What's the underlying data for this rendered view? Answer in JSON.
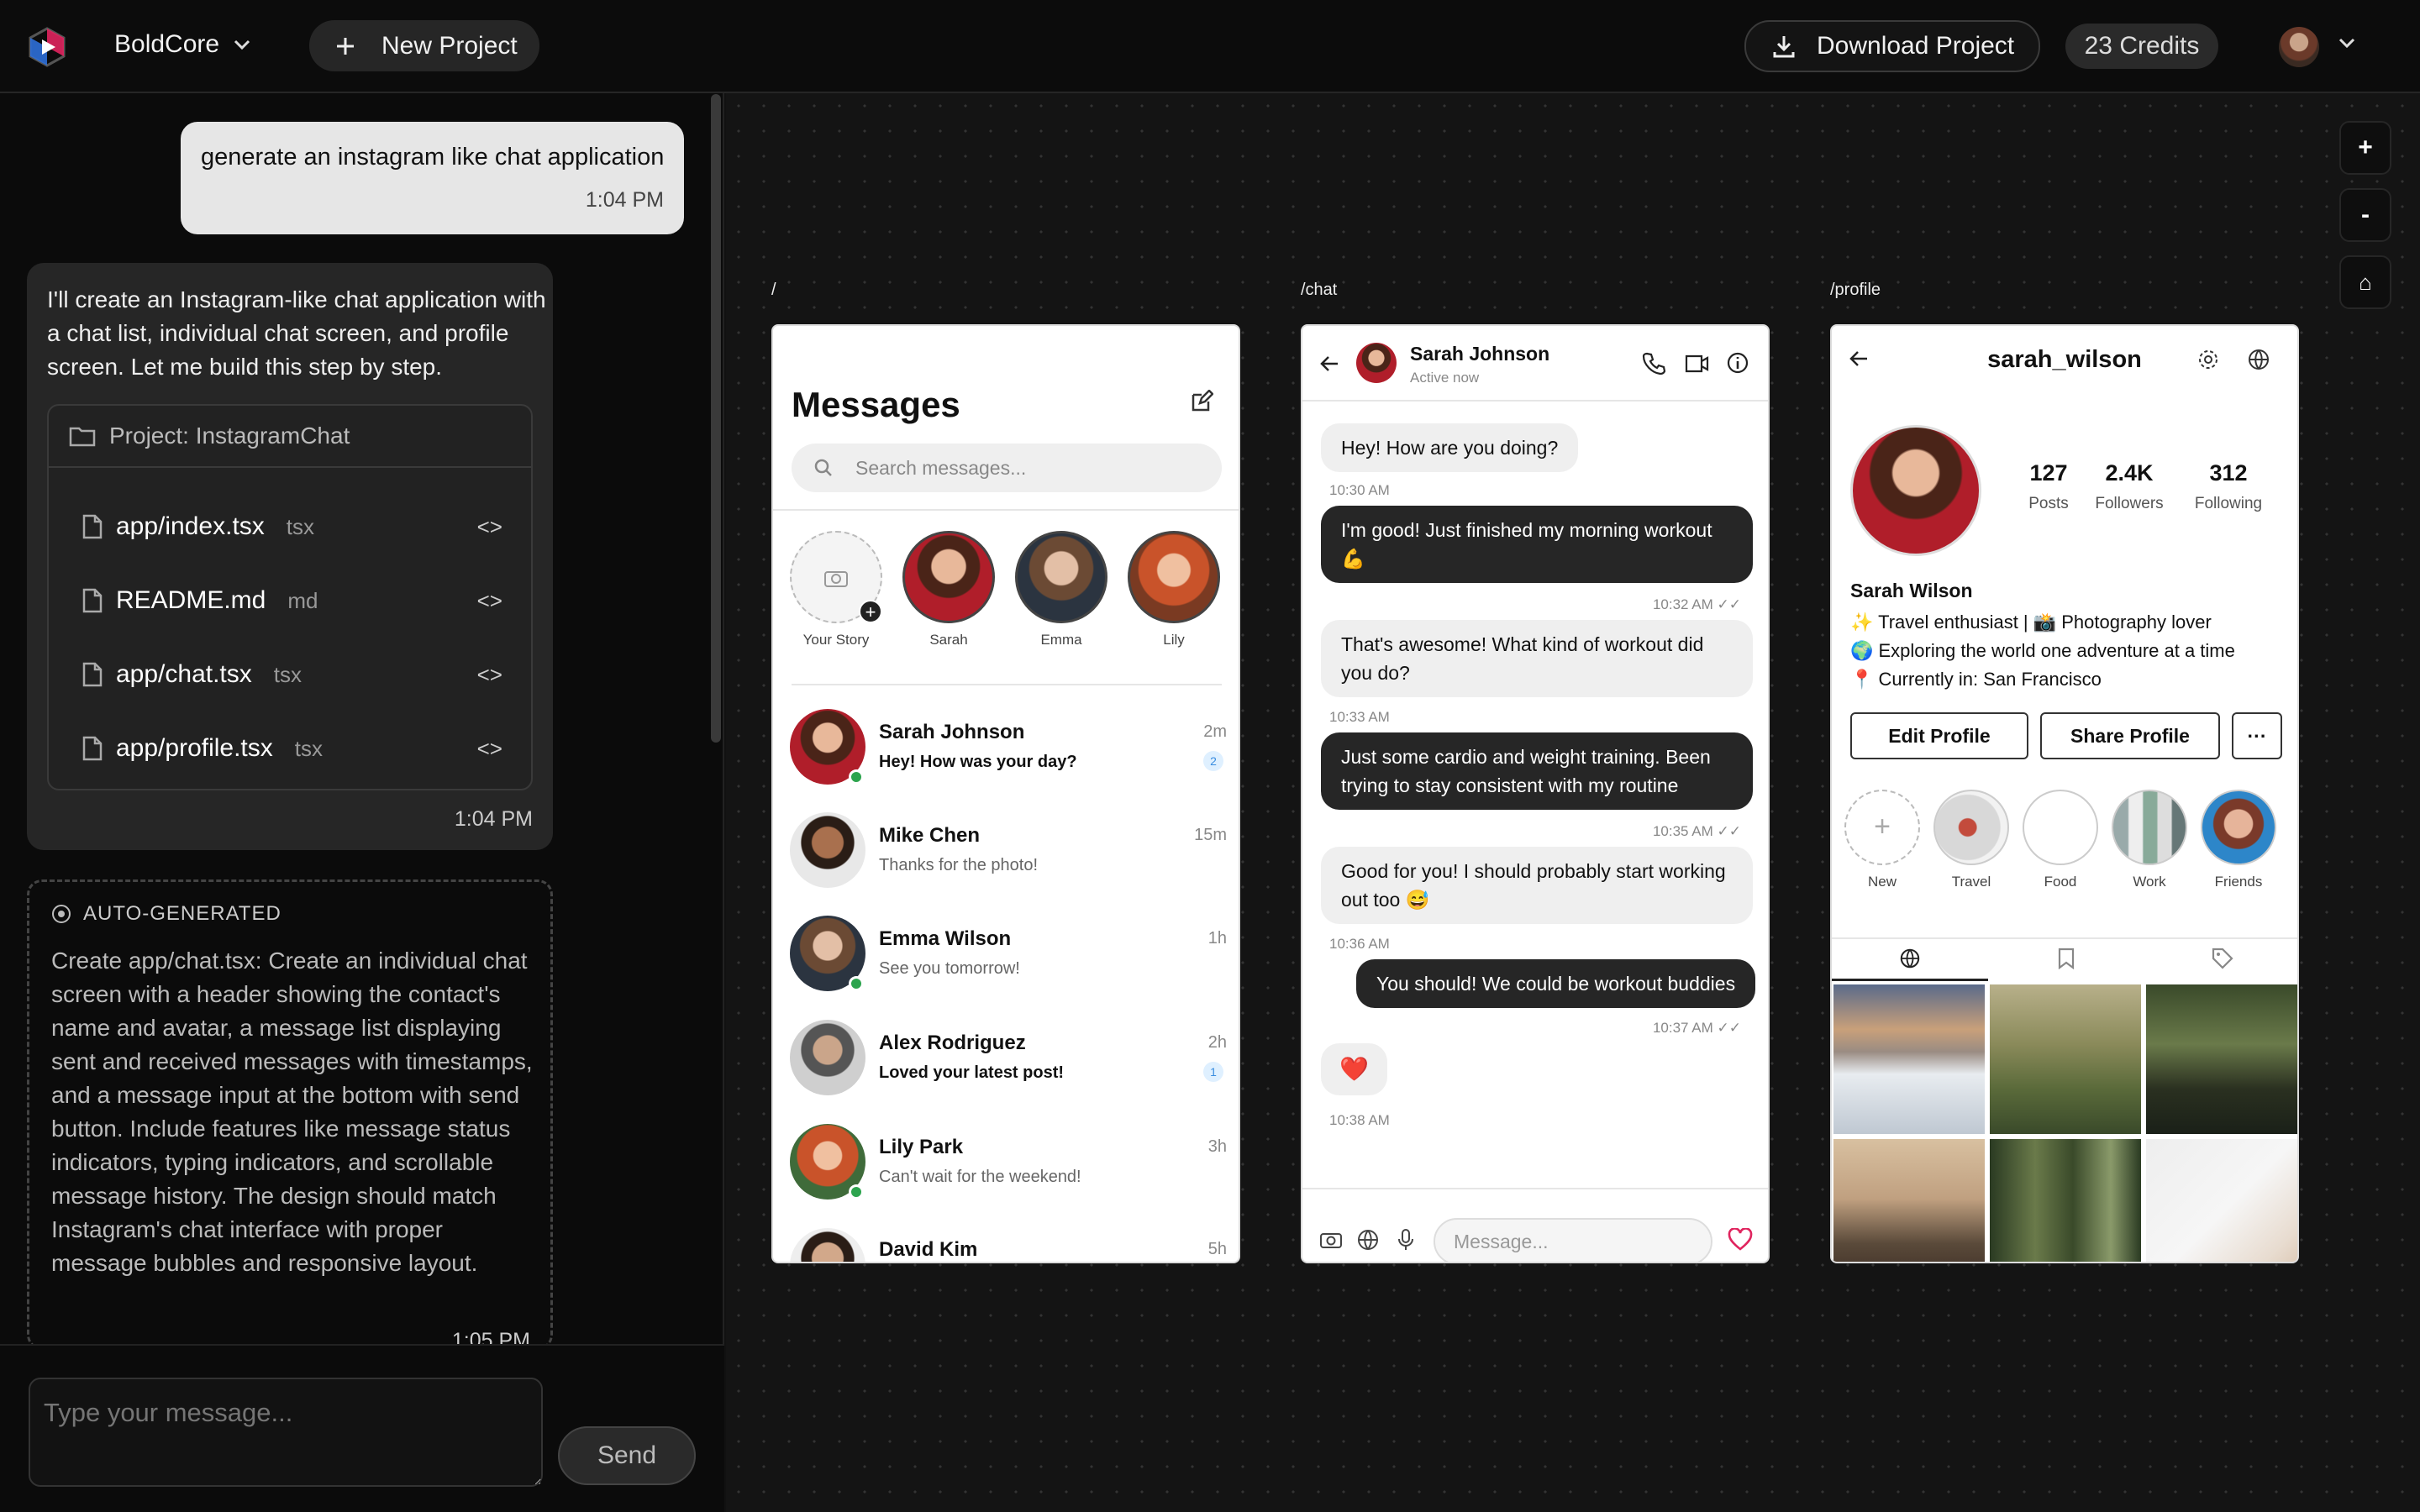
{
  "topbar": {
    "workspace": "BoldCore",
    "new_project": "New Project",
    "download": "Download Project",
    "credits": "23 Credits"
  },
  "chat": {
    "user_message": "generate an instagram like chat application",
    "user_time": "1:04 PM",
    "assistant_message": "I'll create an Instagram-like chat application with a chat list, individual chat screen, and profile screen. Let me build this step by step.",
    "project_title": "Project: InstagramChat",
    "files": [
      {
        "name": "app/index.tsx",
        "ext": "tsx"
      },
      {
        "name": "README.md",
        "ext": "md"
      },
      {
        "name": "app/chat.tsx",
        "ext": "tsx"
      },
      {
        "name": "app/profile.tsx",
        "ext": "tsx"
      }
    ],
    "assistant_time": "1:04 PM",
    "auto_label": "AUTO-GENERATED",
    "auto_text": "Create app/chat.tsx: Create an individual chat screen with a header showing the contact's name and avatar, a message list displaying sent and received messages with timestamps, and a message input at the bottom with send button. Include features like message status indicators, typing indicators, and scrollable message history. The design should match Instagram's chat interface with proper message bubbles and responsive layout.",
    "auto_time": "1:05 PM",
    "input_placeholder": "Type your message...",
    "send": "Send"
  },
  "zoom": {
    "in": "+",
    "out": "-",
    "home": "⌂"
  },
  "routes": {
    "index": "/",
    "chat": "/chat",
    "profile": "/profile"
  },
  "messages_screen": {
    "title": "Messages",
    "search_placeholder": "Search messages...",
    "stories": [
      {
        "label": "Your Story"
      },
      {
        "label": "Sarah"
      },
      {
        "label": "Emma"
      },
      {
        "label": "Lily"
      }
    ],
    "conversations": [
      {
        "name": "Sarah Johnson",
        "preview": "Hey! How was your day?",
        "time": "2m",
        "unread": "2",
        "online": true
      },
      {
        "name": "Mike Chen",
        "preview": "Thanks for the photo!",
        "time": "15m",
        "unread": "",
        "online": false
      },
      {
        "name": "Emma Wilson",
        "preview": "See you tomorrow!",
        "time": "1h",
        "unread": "",
        "online": true
      },
      {
        "name": "Alex Rodriguez",
        "preview": "Loved your latest post!",
        "time": "2h",
        "unread": "1",
        "online": false
      },
      {
        "name": "Lily Park",
        "preview": "Can't wait for the weekend!",
        "time": "3h",
        "unread": "",
        "online": true
      },
      {
        "name": "David Kim",
        "preview": "",
        "time": "5h",
        "unread": "",
        "online": false
      }
    ]
  },
  "chat_screen": {
    "contact": "Sarah Johnson",
    "status": "Active now",
    "messages": [
      {
        "dir": "in",
        "text": "Hey! How are you doing?",
        "time": "10:30 AM"
      },
      {
        "dir": "out",
        "text": "I'm good! Just finished my morning workout 💪",
        "time": "10:32 AM ✓✓"
      },
      {
        "dir": "in",
        "text": "That's awesome! What kind of workout did you do?",
        "time": "10:33 AM"
      },
      {
        "dir": "out",
        "text": "Just some cardio and weight training. Been trying to stay consistent with my routine",
        "time": "10:35 AM ✓✓"
      },
      {
        "dir": "in",
        "text": "Good for you! I should probably start working out too 😅",
        "time": "10:36 AM"
      },
      {
        "dir": "out",
        "text": "You should! We could be workout buddies",
        "time": "10:37 AM ✓✓"
      },
      {
        "dir": "in",
        "text": "❤️",
        "time": "10:38 AM"
      }
    ],
    "input_placeholder": "Message..."
  },
  "profile_screen": {
    "username": "sarah_wilson",
    "stats": [
      {
        "value": "127",
        "label": "Posts"
      },
      {
        "value": "2.4K",
        "label": "Followers"
      },
      {
        "value": "312",
        "label": "Following"
      }
    ],
    "name": "Sarah Wilson",
    "bio": [
      "✨ Travel enthusiast | 📸 Photography lover",
      "🌍 Exploring the world one adventure at a time",
      "📍 Currently in: San Francisco"
    ],
    "edit": "Edit Profile",
    "share": "Share Profile",
    "more": "···",
    "highlights": [
      {
        "label": "New"
      },
      {
        "label": "Travel"
      },
      {
        "label": "Food"
      },
      {
        "label": "Work"
      },
      {
        "label": "Friends"
      }
    ]
  },
  "colors": {
    "accent_online": "#2da44e",
    "heart": "#e0245e",
    "badge": "#3a8de0"
  }
}
